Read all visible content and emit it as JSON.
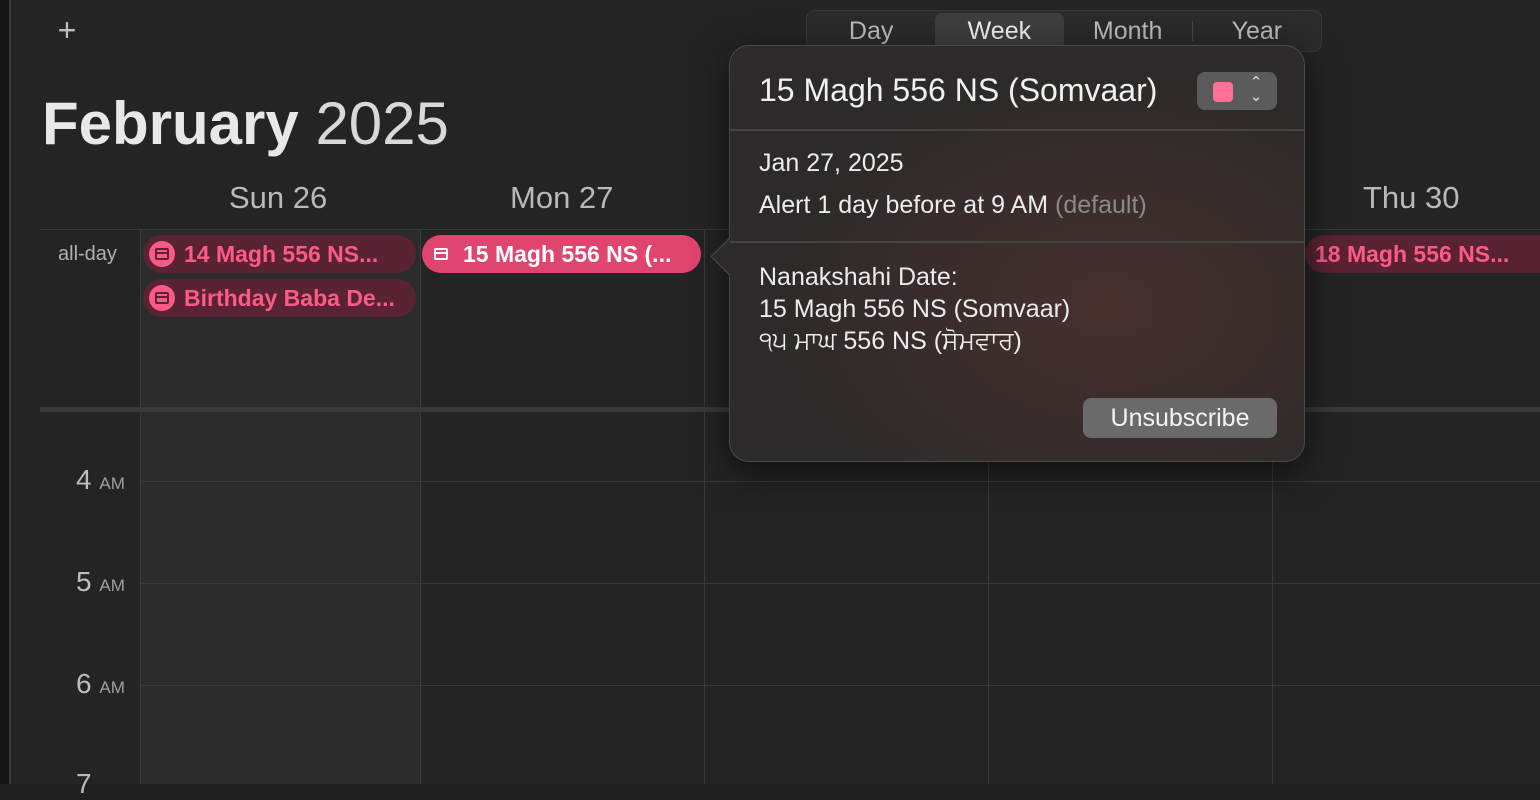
{
  "toolbar": {
    "add_symbol": "+"
  },
  "view_switcher": {
    "items": [
      "Day",
      "Week",
      "Month",
      "Year"
    ],
    "selected": "Week"
  },
  "header": {
    "month": "February",
    "year": "2025"
  },
  "days": [
    {
      "label": "Sun 26"
    },
    {
      "label": "Mon 27"
    },
    {
      "label": "Thu 30"
    }
  ],
  "allday_label": "all-day",
  "hours": [
    {
      "num": "4",
      "suffix": "AM"
    },
    {
      "num": "5",
      "suffix": "AM"
    },
    {
      "num": "6",
      "suffix": "AM"
    },
    {
      "num": "7",
      "suffix": ""
    }
  ],
  "events": {
    "sun_1": "14 Magh 556 NS...",
    "sun_2": "Birthday Baba De...",
    "mon_1": "15 Magh 556 NS (...",
    "thu_1": "18 Magh 556 NS..."
  },
  "popover": {
    "title": "15 Magh 556 NS (Somvaar)",
    "calendar_color": "#ff6f96",
    "date": "Jan 27, 2025",
    "alert": "Alert 1 day before at 9 AM",
    "alert_default": "(default)",
    "notes_line1": "Nanakshahi Date:",
    "notes_line2": "15 Magh 556 NS (Somvaar)",
    "notes_line3": "੧੫ ਮਾਘ 556 NS (ਸੋਮਵਾਰ)",
    "unsubscribe": "Unsubscribe"
  },
  "colors": {
    "event_accent": "#e0456f",
    "event_dim_bg": "#5a2334",
    "event_dim_text": "#ff5a86"
  }
}
